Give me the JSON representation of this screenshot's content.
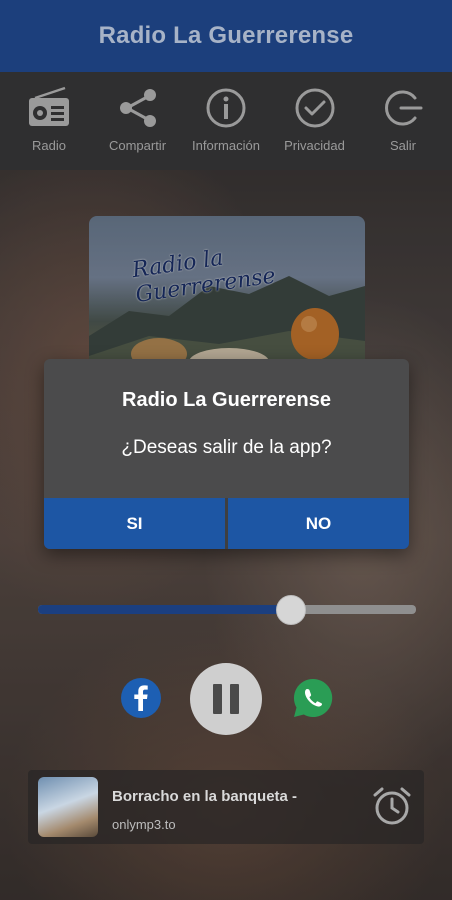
{
  "app": {
    "title": "Radio La Guerrerense"
  },
  "toolbar": {
    "items": [
      {
        "label": "Radio",
        "icon": "radio-icon"
      },
      {
        "label": "Compartir",
        "icon": "share-icon"
      },
      {
        "label": "Información",
        "icon": "info-icon"
      },
      {
        "label": "Privacidad",
        "icon": "check-circle-icon"
      },
      {
        "label": "Salir",
        "icon": "exit-icon"
      }
    ]
  },
  "artwork": {
    "script_text": "Radio la Guerrerense"
  },
  "dialog": {
    "title": "Radio La Guerrerense",
    "message": "¿Deseas salir de la app?",
    "yes_label": "SI",
    "no_label": "NO"
  },
  "player": {
    "volume": 0.67,
    "state": "playing"
  },
  "now_playing": {
    "title": "Borracho en la banqueta -",
    "subtitle": "onlymp3.to"
  },
  "colors": {
    "header": "#1c3f7c",
    "dialog_button": "#1d56a4",
    "slider_fill": "#1b3f80",
    "facebook": "#1d5fb3",
    "whatsapp": "#2a9d55"
  }
}
